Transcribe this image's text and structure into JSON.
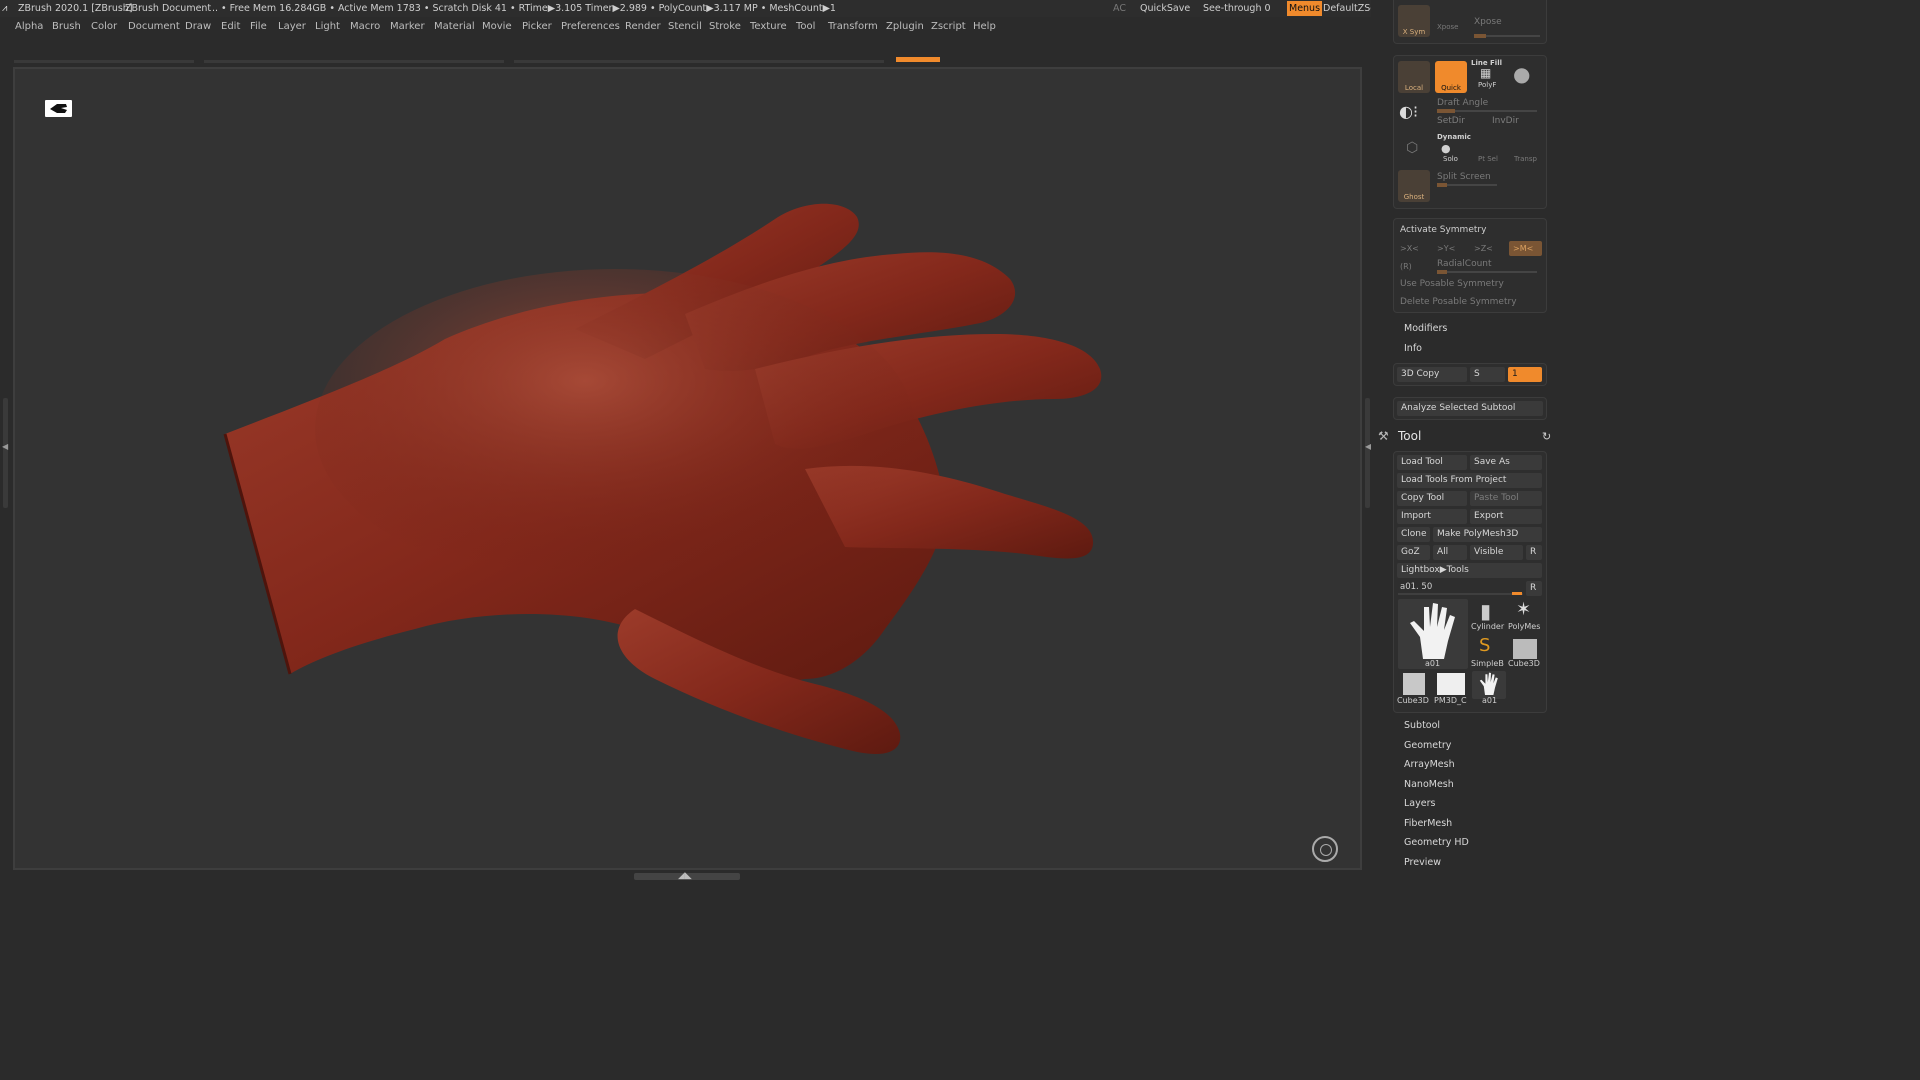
{
  "title_bar": {
    "app": "ZBrush 2020.1 [ZBrush]",
    "document": "ZBrush Document",
    "stats": ".. • Free Mem 16.284GB • Active Mem 1783 • Scratch Disk 41 • RTime▶3.105 Timer▶2.989 • PolyCount▶3.117 MP • MeshCount▶1",
    "ac": "AC",
    "quicksave": "QuickSave",
    "see_through": "See-through  0",
    "menus": "Menus",
    "default_zscript": "DefaultZScript"
  },
  "menu_bar": [
    "Alpha",
    "Brush",
    "Color",
    "Document",
    "Draw",
    "Edit",
    "File",
    "Layer",
    "Light",
    "Macro",
    "Marker",
    "Material",
    "Movie",
    "Picker",
    "Preferences",
    "Render",
    "Stencil",
    "Stroke",
    "Texture",
    "Tool",
    "Transform",
    "Zplugin",
    "Zscript",
    "Help"
  ],
  "colors": {
    "accent": "#f08a2c",
    "model": "#8a2a1c",
    "viewport": "#333333"
  },
  "tray": {
    "top_panel": {
      "xsym_label": "X Sym",
      "xpose_label": "Xpose",
      "xpose_top": "Xpose",
      "local_label": "Local",
      "quick_label": "Quick",
      "linefill_label": "Line Fill",
      "polyf_label": "PolyF",
      "draft_angle": "Draft Angle",
      "setdir": "SetDir",
      "invdir": "InvDir",
      "dynamic_label": "Dynamic",
      "solo_label": "Solo",
      "ptsel_label": "Pt Sel",
      "transp_label": "Transp",
      "split_screen": "Split Screen",
      "ghost_label": "Ghost"
    },
    "symmetry": {
      "title": "Activate Symmetry",
      "axes": [
        ">X<",
        ">Y<",
        ">Z<",
        ">M<"
      ],
      "r_label": "(R)",
      "radial_count": "RadialCount",
      "use_posable": "Use Posable Symmetry",
      "delete_posable": "Delete Posable Symmetry"
    },
    "modifiers": "Modifiers",
    "info": "Info",
    "copy3d": {
      "label": "3D Copy",
      "s": "S",
      "value": "1"
    },
    "analyze": "Analyze Selected Subtool",
    "tool": {
      "title": "Tool",
      "load_tool": "Load Tool",
      "save_as": "Save As",
      "load_from_project": "Load Tools From Project",
      "copy_tool": "Copy Tool",
      "paste_tool": "Paste Tool",
      "import": "Import",
      "export": "Export",
      "clone": "Clone",
      "make_polymesh": "Make PolyMesh3D",
      "goz": "GoZ",
      "all": "All",
      "visible": "Visible",
      "r": "R",
      "lightbox_tools": "Lightbox▶Tools",
      "current_tool": "a01. 50",
      "thumbs": [
        "a01",
        "Cylinder",
        "PolyMes",
        "SimpleB",
        "Cube3D",
        "Cube3D",
        "PM3D_C",
        "a01"
      ]
    },
    "sections": [
      "Subtool",
      "Geometry",
      "ArrayMesh",
      "NanoMesh",
      "Layers",
      "FiberMesh",
      "Geometry HD",
      "Preview"
    ]
  }
}
